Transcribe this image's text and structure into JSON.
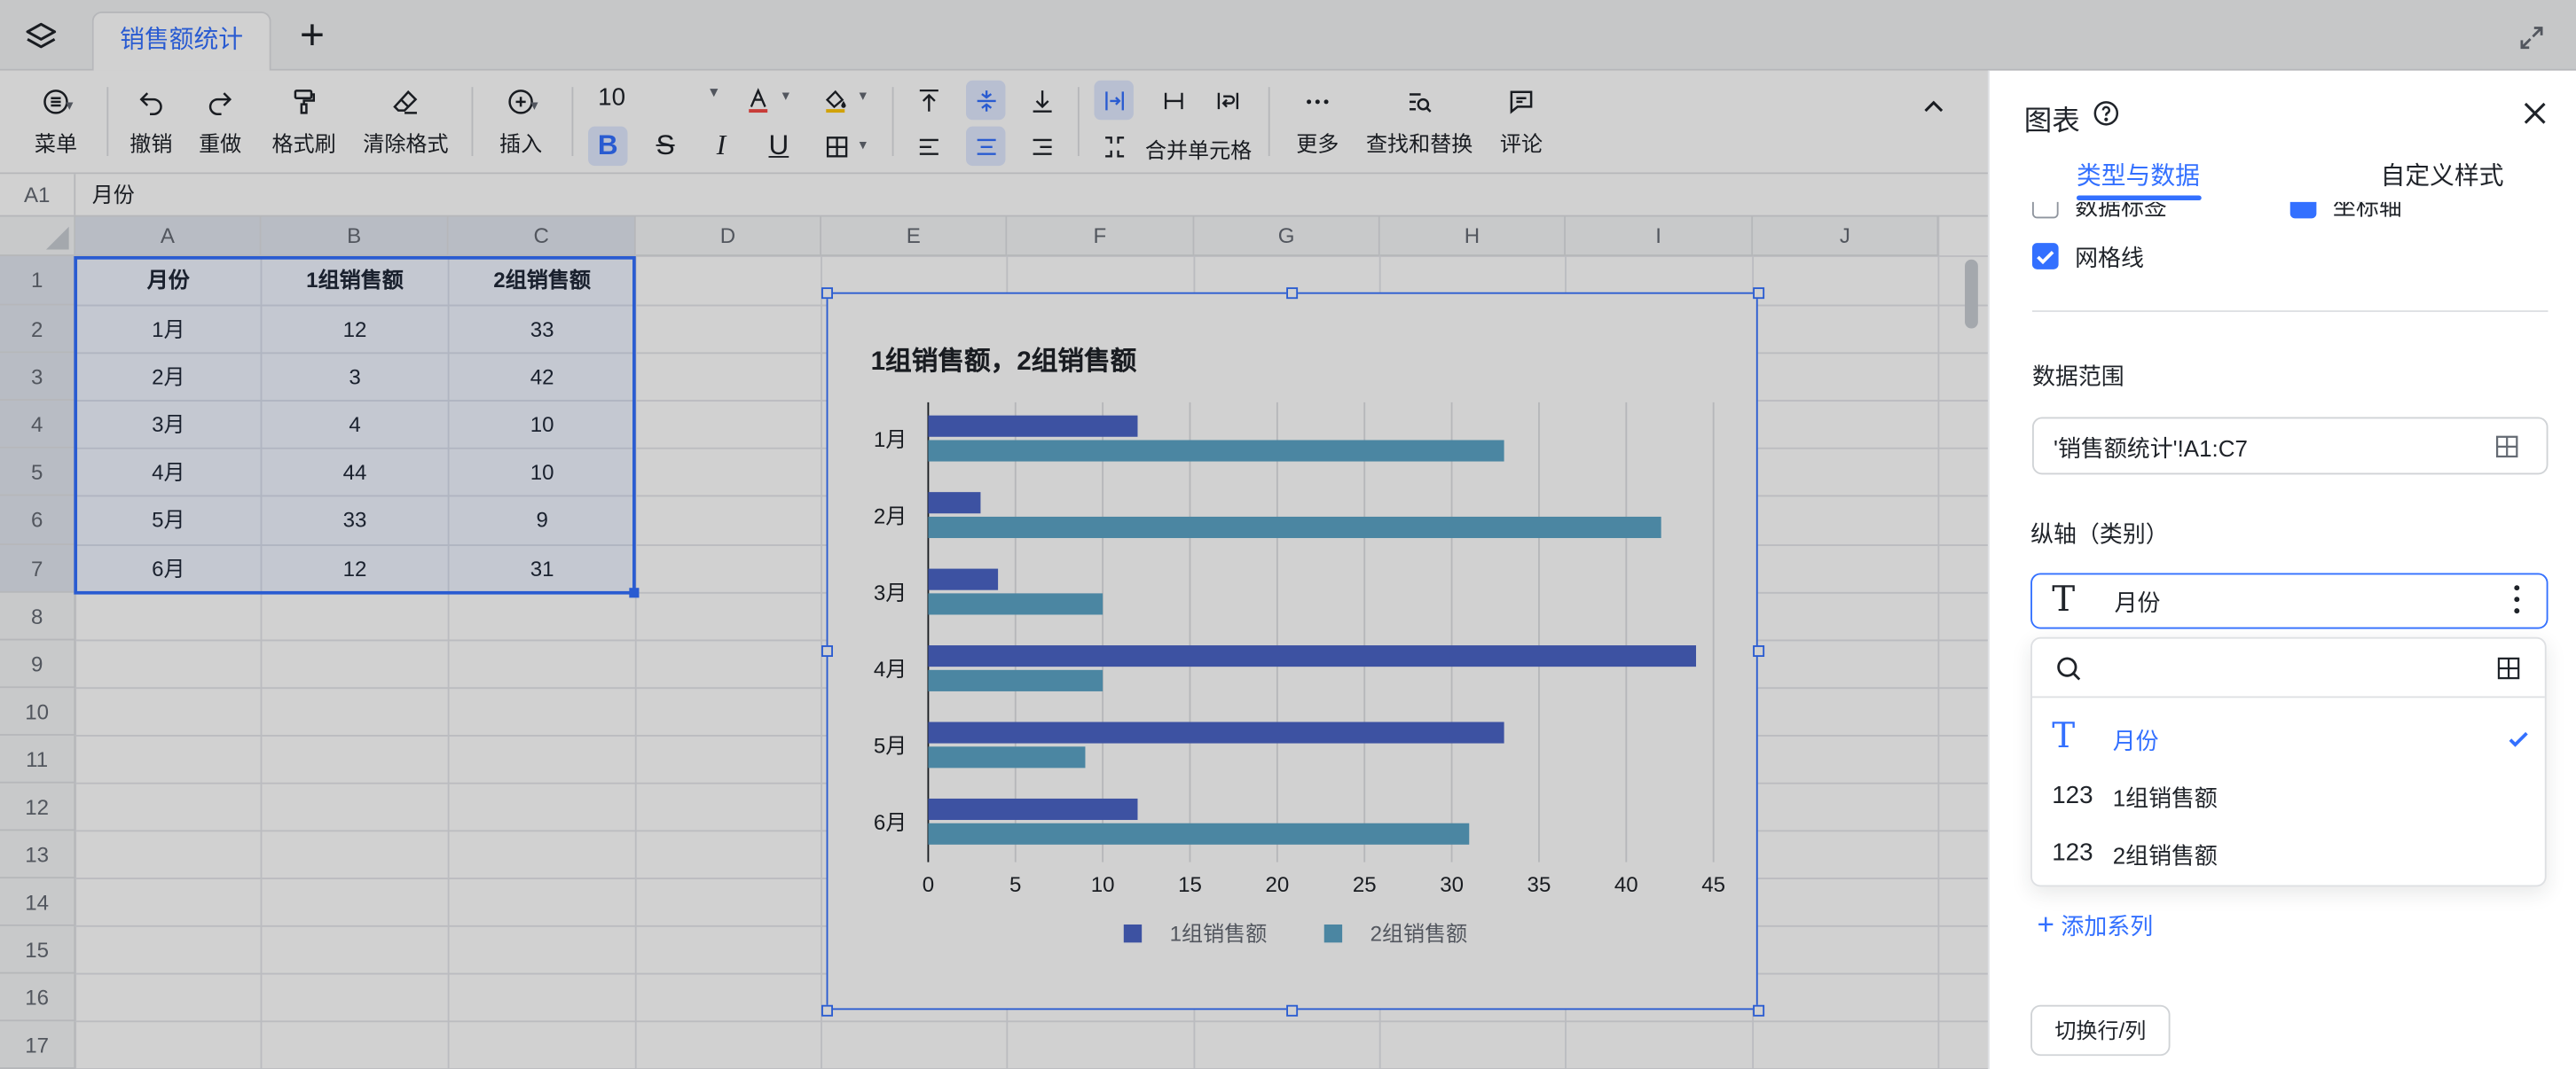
{
  "app": {
    "layers_icon": "layers-icon",
    "expand_icon": "fullscreen-icon"
  },
  "tabs": [
    {
      "label": "销售额统计"
    }
  ],
  "toolbar": {
    "menu": "菜单",
    "undo": "撤销",
    "redo": "重做",
    "format_painter": "格式刷",
    "clear_format": "清除格式",
    "insert": "插入",
    "font_size": "10",
    "merge": "合并单元格",
    "more": "更多",
    "find_replace": "查找和替换",
    "comment": "评论"
  },
  "formula": {
    "cell_ref": "A1",
    "content": "月份"
  },
  "columns": [
    "A",
    "B",
    "C",
    "D",
    "E",
    "F",
    "G",
    "H",
    "I",
    "J"
  ],
  "rows": [
    "1",
    "2",
    "3",
    "4",
    "5",
    "6",
    "7",
    "8",
    "9",
    "10",
    "11",
    "12",
    "13",
    "14",
    "15",
    "16",
    "17"
  ],
  "table": {
    "header": [
      "月份",
      "1组销售额",
      "2组销售额"
    ],
    "rows": [
      [
        "1月",
        "12",
        "33"
      ],
      [
        "2月",
        "3",
        "42"
      ],
      [
        "3月",
        "4",
        "10"
      ],
      [
        "4月",
        "44",
        "10"
      ],
      [
        "5月",
        "33",
        "9"
      ],
      [
        "6月",
        "12",
        "31"
      ]
    ]
  },
  "chart_data": {
    "type": "bar",
    "orientation": "horizontal",
    "title": "1组销售额，2组销售额",
    "categories": [
      "1月",
      "2月",
      "3月",
      "4月",
      "5月",
      "6月"
    ],
    "series": [
      {
        "name": "1组销售额",
        "values": [
          12,
          3,
          4,
          44,
          33,
          12
        ],
        "color": "#4b64c6"
      },
      {
        "name": "2组销售额",
        "values": [
          33,
          42,
          10,
          10,
          9,
          31
        ],
        "color": "#5ca4c6"
      }
    ],
    "xlim": [
      0,
      45
    ],
    "xticks": [
      "0",
      "5",
      "10",
      "15",
      "20",
      "25",
      "30",
      "35",
      "40",
      "45"
    ],
    "grid": true,
    "legend": "bottom"
  },
  "panel": {
    "title": "图表",
    "tabs": [
      "类型与数据",
      "自定义样式"
    ],
    "checkbox_data_labels": "数据标签",
    "checkbox_axis": "坐标轴",
    "checkbox_gridlines": "网格线",
    "data_range_label": "数据范围",
    "data_range_value": "'销售额统计'!A1:C7",
    "vaxis_label": "纵轴（类别）",
    "vaxis_value": "月份",
    "dropdown_options": [
      {
        "type_icon": "T",
        "label": "月份",
        "selected": true
      },
      {
        "type_icon": "123",
        "label": "1组销售额",
        "selected": false
      },
      {
        "type_icon": "123",
        "label": "2组销售额",
        "selected": false
      }
    ],
    "add_series": "添加系列",
    "switch_row_col": "切换行/列",
    "accent": "#3370ff"
  }
}
